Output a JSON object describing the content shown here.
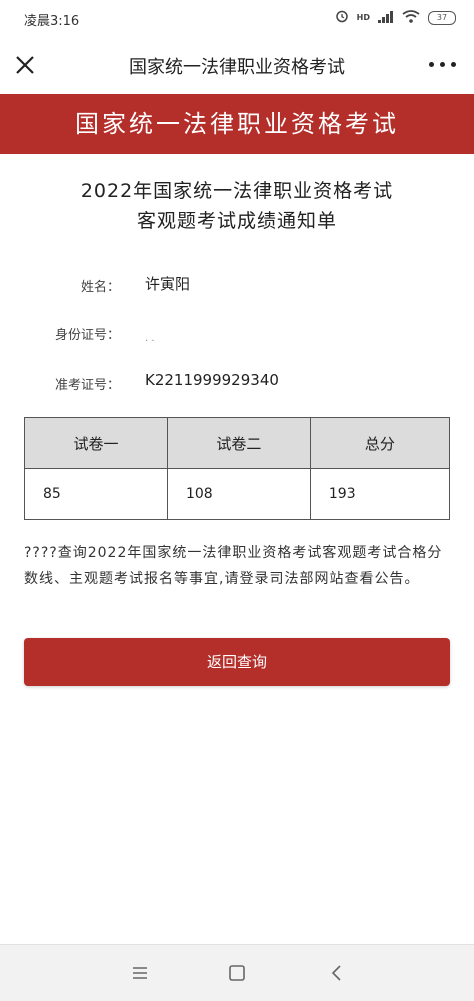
{
  "status_bar": {
    "time": "凌晨3:16",
    "battery": "37",
    "signal_tag": "HD"
  },
  "header": {
    "title": "国家统一法律职业资格考试",
    "close_icon": "close-icon",
    "more_icon": "more-icon"
  },
  "banner": {
    "text": "国家统一法律职业资格考试"
  },
  "document": {
    "title_line1": "2022年国家统一法律职业资格考试",
    "title_line2": "客观题考试成绩通知单"
  },
  "fields": {
    "name_label": "姓名：",
    "name_value": "许寅阳",
    "id_label": "身份证号：",
    "id_value": "· ·",
    "exam_no_label": "准考证号：",
    "exam_no_value": "K2211999929340"
  },
  "scores": {
    "headers": [
      "试卷一",
      "试卷二",
      "总分"
    ],
    "values": [
      "85",
      "108",
      "193"
    ]
  },
  "notice": "????查询2022年国家统一法律职业资格考试客观题考试合格分数线、主观题考试报名等事宜,请登录司法部网站查看公告。",
  "actions": {
    "back_label": "返回查询"
  },
  "colors": {
    "brand_red": "#b42e2a",
    "table_header": "#dcdcdc"
  }
}
